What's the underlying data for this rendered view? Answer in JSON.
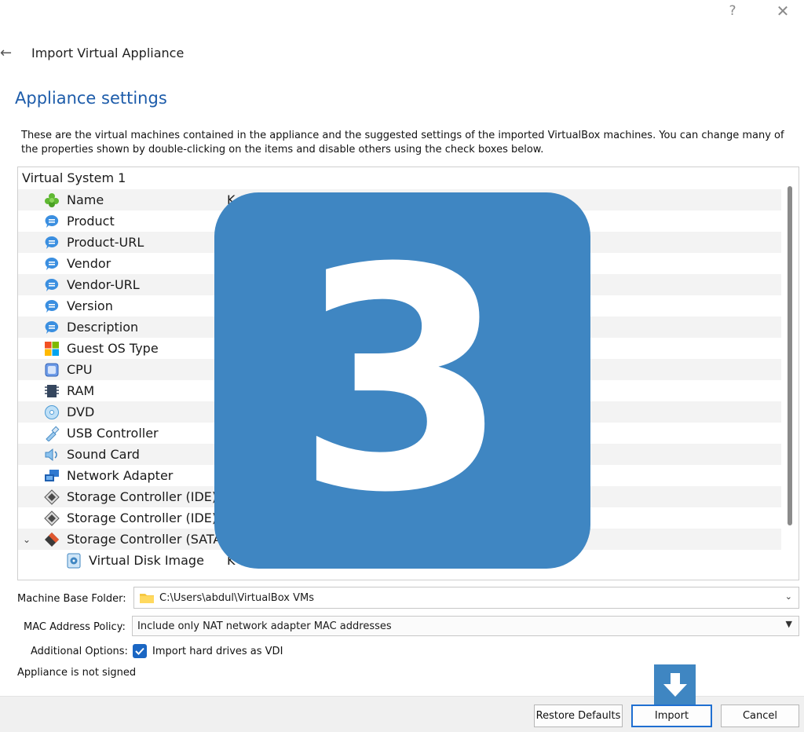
{
  "titlebar": {
    "help_label": "?",
    "close_label": "✕"
  },
  "wizard": {
    "back_label": "←",
    "title": "Import Virtual Appliance"
  },
  "page": {
    "heading": "Appliance settings",
    "description": "These are the virtual machines contained in the appliance and the suggested settings of the imported VirtualBox machines. You can change many of the properties shown by double-clicking on the items and disable others using the check boxes below."
  },
  "tree": {
    "root_label": "Virtual System 1",
    "items": [
      {
        "label": "Name",
        "icon": "name-icon",
        "value": "K"
      },
      {
        "label": "Product",
        "icon": "info-bubble-icon",
        "value": ""
      },
      {
        "label": "Product-URL",
        "icon": "info-bubble-icon",
        "value": ""
      },
      {
        "label": "Vendor",
        "icon": "info-bubble-icon",
        "value": ""
      },
      {
        "label": "Vendor-URL",
        "icon": "info-bubble-icon",
        "value": ""
      },
      {
        "label": "Version",
        "icon": "info-bubble-icon",
        "value": ""
      },
      {
        "label": "Description",
        "icon": "info-bubble-icon",
        "value": ""
      },
      {
        "label": "Guest OS Type",
        "icon": "os-type-icon",
        "value": ""
      },
      {
        "label": "CPU",
        "icon": "cpu-icon",
        "value": ""
      },
      {
        "label": "RAM",
        "icon": "ram-icon",
        "value": ""
      },
      {
        "label": "DVD",
        "icon": "dvd-icon",
        "value": ""
      },
      {
        "label": "USB Controller",
        "icon": "usb-icon",
        "value": ""
      },
      {
        "label": "Sound Card",
        "icon": "sound-icon",
        "value": ""
      },
      {
        "label": "Network Adapter",
        "icon": "network-icon",
        "value": ""
      },
      {
        "label": "Storage Controller (IDE)",
        "icon": "ide-controller-icon",
        "value": ""
      },
      {
        "label": "Storage Controller (IDE)",
        "icon": "ide-controller-icon",
        "value": ""
      },
      {
        "label": "Storage Controller (SATA)",
        "icon": "sata-controller-icon",
        "value": ""
      },
      {
        "label": "Virtual Disk Image",
        "icon": "disk-image-icon",
        "value": "K"
      }
    ]
  },
  "form": {
    "folder_label": "Machine Base Folder:",
    "folder_value": "C:\\Users\\abdul\\VirtualBox VMs",
    "mac_label": "MAC Address Policy:",
    "mac_value": "Include only NAT network adapter MAC addresses",
    "options_label": "Additional Options:",
    "vdi_label": "Import hard drives as VDI",
    "vdi_checked": true
  },
  "status": {
    "signed_text": "Appliance is not signed"
  },
  "buttons": {
    "restore": "Restore Defaults",
    "import": "Import",
    "cancel": "Cancel"
  },
  "overlay": {
    "step_number": "3"
  },
  "colors": {
    "accent": "#1d5caa",
    "overlay": "#3f86c2",
    "checkbox": "#1a66c3"
  }
}
